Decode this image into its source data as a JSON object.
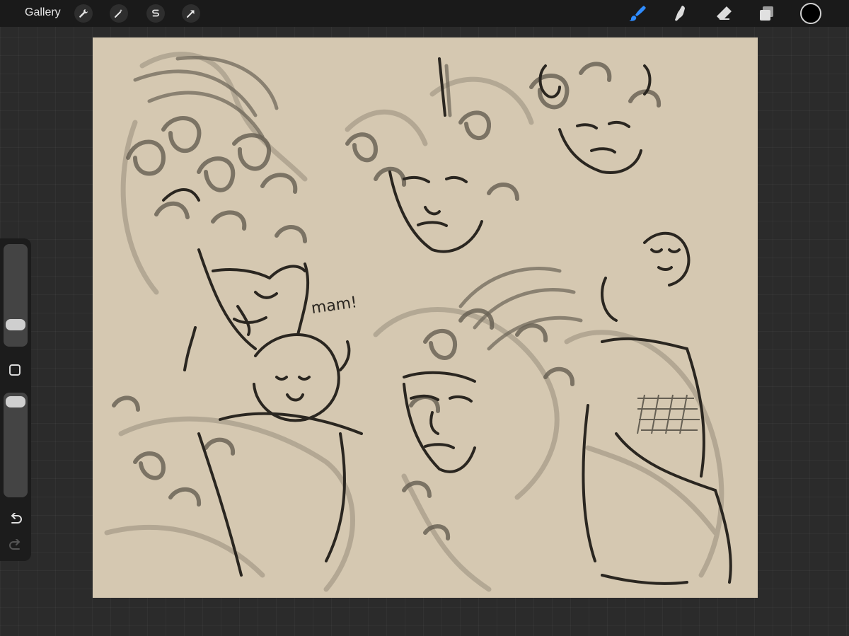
{
  "app": {
    "gallery_label": "Gallery"
  },
  "toolbar_left": [
    {
      "name": "actions-wrench-icon"
    },
    {
      "name": "adjustments-magic-wand-icon"
    },
    {
      "name": "selection-s-icon"
    },
    {
      "name": "transform-arrow-icon"
    }
  ],
  "toolbar_right": [
    {
      "name": "brush-icon",
      "active": true
    },
    {
      "name": "smudge-icon",
      "active": false
    },
    {
      "name": "eraser-icon",
      "active": false
    },
    {
      "name": "layers-icon",
      "active": false
    }
  ],
  "current_color": "#000000",
  "colors": {
    "accent": "#2f8cff",
    "canvas_paper": "#d5c8b1",
    "ink": "#2a2620"
  },
  "canvas": {
    "annotation_text": "mam!"
  }
}
